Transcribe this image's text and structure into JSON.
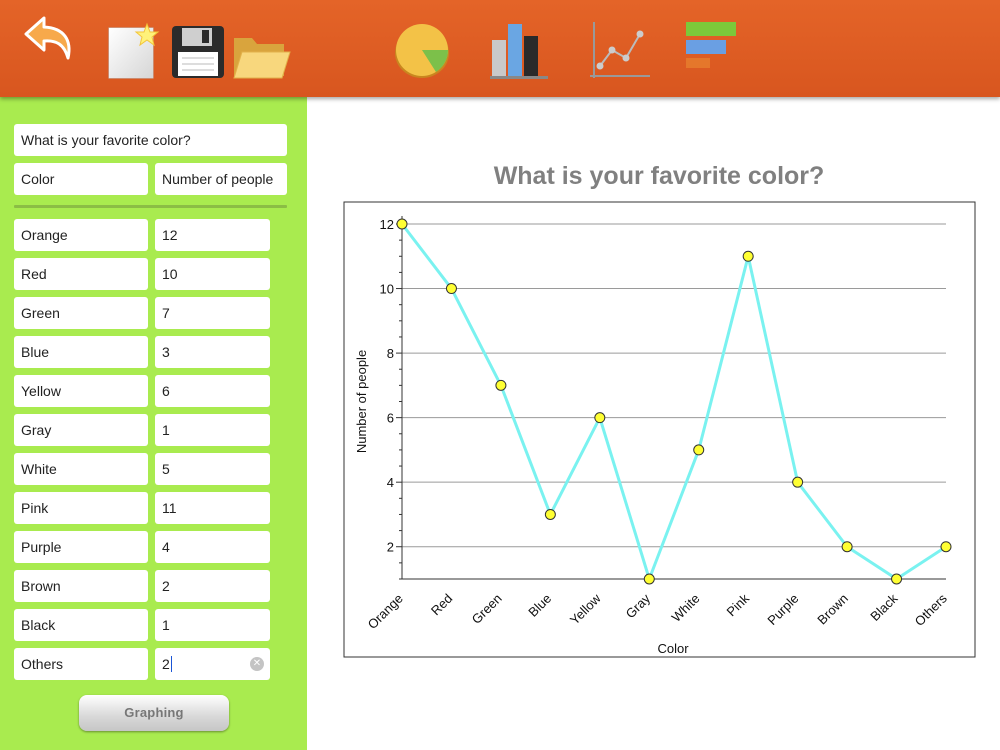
{
  "toolbar": {
    "buttons": [
      {
        "icon": "undo-arrow-icon"
      },
      {
        "icon": "new-document-icon"
      },
      {
        "icon": "save-floppy-icon"
      },
      {
        "icon": "open-folder-icon"
      },
      {
        "icon": "pie-chart-icon"
      },
      {
        "icon": "bar-chart-icon"
      },
      {
        "icon": "line-chart-icon"
      },
      {
        "icon": "horizontal-bar-chart-icon"
      }
    ],
    "accent": "#e0602a"
  },
  "form": {
    "title_value": "What is your favorite color?",
    "label_header": "Color",
    "value_header": "Number of people",
    "rows": [
      {
        "label": "Orange",
        "value": "12"
      },
      {
        "label": "Red",
        "value": "10"
      },
      {
        "label": "Green",
        "value": "7"
      },
      {
        "label": "Blue",
        "value": "3"
      },
      {
        "label": "Yellow",
        "value": "6"
      },
      {
        "label": "Gray",
        "value": "1"
      },
      {
        "label": "White",
        "value": "5"
      },
      {
        "label": "Pink",
        "value": "11"
      },
      {
        "label": "Purple",
        "value": "4"
      },
      {
        "label": "Brown",
        "value": "2"
      },
      {
        "label": "Black",
        "value": "1"
      },
      {
        "label": "Others",
        "value": "2"
      }
    ],
    "graphing_button": "Graphing",
    "sidebar_color": "#a9eb4f"
  },
  "chart_data": {
    "type": "line",
    "title": "What is your favorite color?",
    "xlabel": "Color",
    "ylabel": "Number of people",
    "categories": [
      "Orange",
      "Red",
      "Green",
      "Blue",
      "Yellow",
      "Gray",
      "White",
      "Pink",
      "Purple",
      "Brown",
      "Black",
      "Others"
    ],
    "values": [
      12,
      10,
      7,
      3,
      6,
      1,
      5,
      11,
      4,
      2,
      1,
      2
    ],
    "yticks": [
      2,
      4,
      6,
      8,
      10,
      12
    ],
    "ylim": [
      1,
      12
    ],
    "grid": true,
    "line_color": "#7af2f0",
    "marker_color": "#ffff33"
  }
}
